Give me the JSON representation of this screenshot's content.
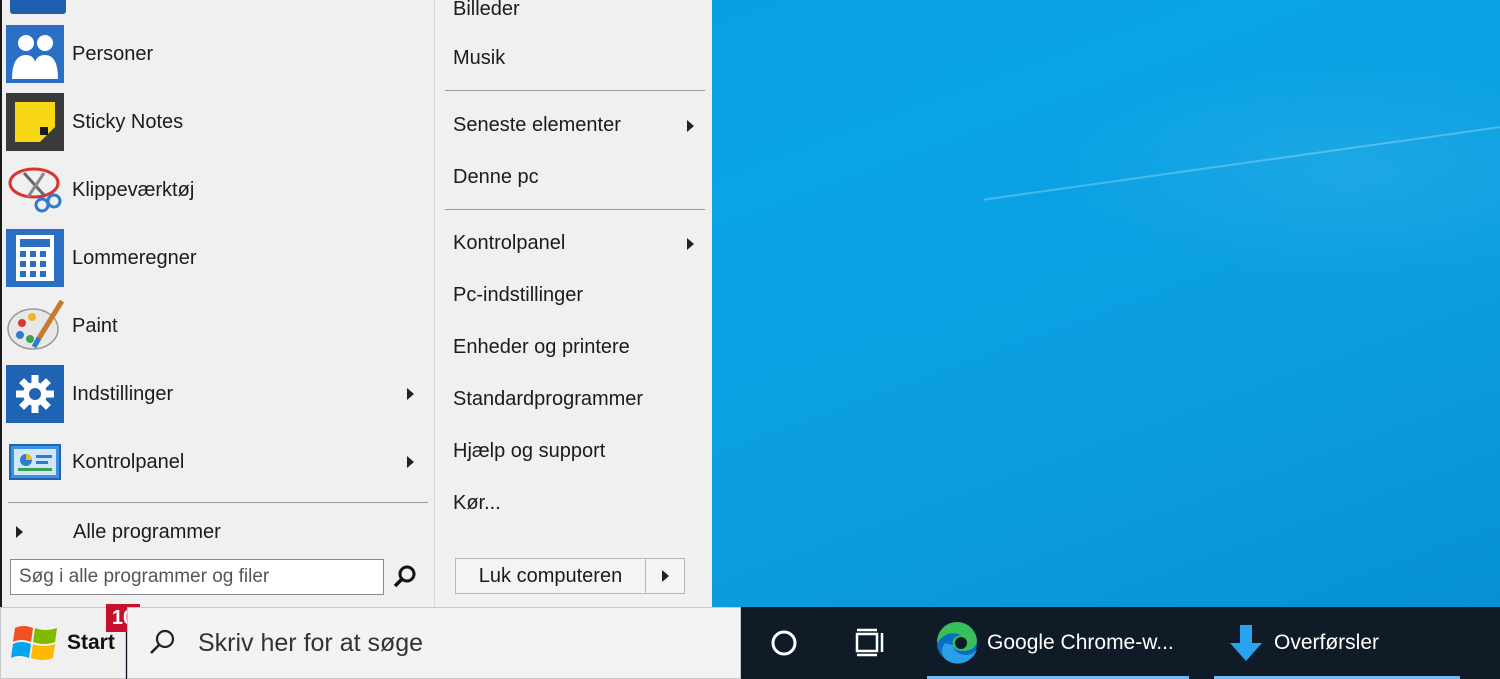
{
  "start_menu": {
    "apps": [
      {
        "label": "Personer",
        "icon": "people-icon",
        "has_submenu": false
      },
      {
        "label": "Sticky Notes",
        "icon": "sticky-notes-icon",
        "has_submenu": false
      },
      {
        "label": "Klippeværktøj",
        "icon": "snipping-tool-icon",
        "has_submenu": false
      },
      {
        "label": "Lommeregner",
        "icon": "calculator-icon",
        "has_submenu": false
      },
      {
        "label": "Paint",
        "icon": "paint-palette-icon",
        "has_submenu": false
      },
      {
        "label": "Indstillinger",
        "icon": "gear-icon",
        "has_submenu": true
      },
      {
        "label": "Kontrolpanel",
        "icon": "control-panel-icon",
        "has_submenu": true
      }
    ],
    "all_programs_label": "Alle programmer",
    "search": {
      "placeholder": "Søg i alle programmer og filer",
      "value": ""
    },
    "places": [
      {
        "label": "Billeder",
        "has_submenu": false
      },
      {
        "label": "Musik",
        "has_submenu": false
      },
      {
        "label": "Seneste elementer",
        "has_submenu": true
      },
      {
        "label": "Denne pc",
        "has_submenu": false
      },
      {
        "label": "Kontrolpanel",
        "has_submenu": true
      },
      {
        "label": "Pc-indstillinger",
        "has_submenu": false
      },
      {
        "label": "Enheder og printere",
        "has_submenu": false
      },
      {
        "label": "Standardprogrammer",
        "has_submenu": false
      },
      {
        "label": "Hjælp og support",
        "has_submenu": false
      },
      {
        "label": "Kør...",
        "has_submenu": false
      }
    ],
    "shutdown_label": "Luk computeren"
  },
  "taskbar": {
    "start_label": "Start",
    "start_badge": "10",
    "search_placeholder": "Skriv her for at søge",
    "apps": [
      {
        "label": "Google Chrome-w...",
        "icon": "edge-icon"
      },
      {
        "label": "Overførsler",
        "icon": "download-arrow-icon"
      }
    ]
  },
  "colors": {
    "desktop": "#0aa3e6",
    "menu_bg": "#f0f0f0",
    "taskbar_bg": "#0f1c27",
    "badge": "#c8102e",
    "active_underline": "#76b9ed"
  }
}
